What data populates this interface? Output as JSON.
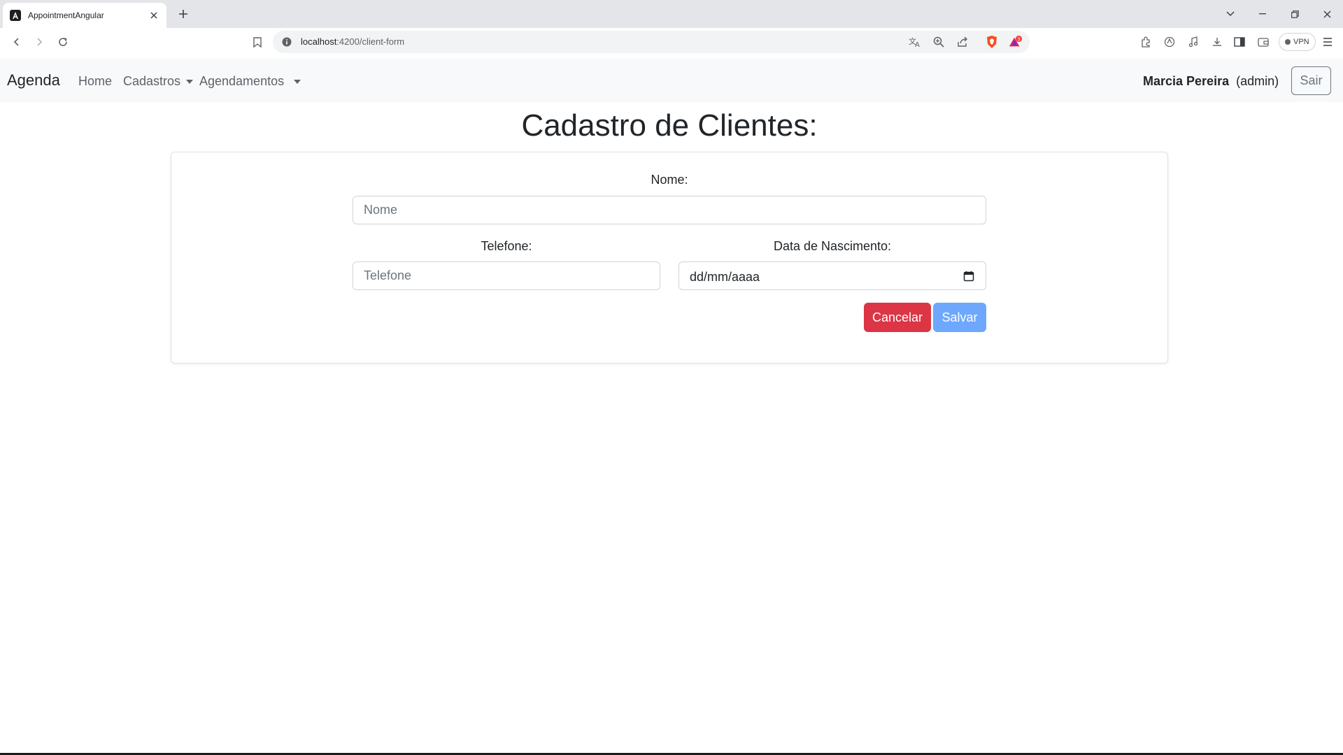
{
  "browser": {
    "tab_title": "AppointmentAngular",
    "url_host": "localhost",
    "url_path": ":4200/client-form",
    "vpn_label": "VPN",
    "brave_rewards_badge": "3"
  },
  "navbar": {
    "brand": "Agenda",
    "links": [
      {
        "label": "Home"
      },
      {
        "label": "Cadastros"
      },
      {
        "label": "Agendamentos"
      }
    ],
    "user_name": "Marcia Pereira",
    "user_role": "(admin)",
    "logout_label": "Sair"
  },
  "page": {
    "title": "Cadastro de Clientes:"
  },
  "form": {
    "name_label": "Nome:",
    "name_placeholder": "Nome",
    "phone_label": "Telefone:",
    "phone_placeholder": "Telefone",
    "birth_label": "Data de Nascimento:",
    "birth_value": "dd/mm/aaaa",
    "cancel_label": "Cancelar",
    "save_label": "Salvar"
  },
  "colors": {
    "danger": "#dc3545",
    "primary_disabled": "#6ea8fe",
    "navbar_bg": "#f8f9fa"
  }
}
